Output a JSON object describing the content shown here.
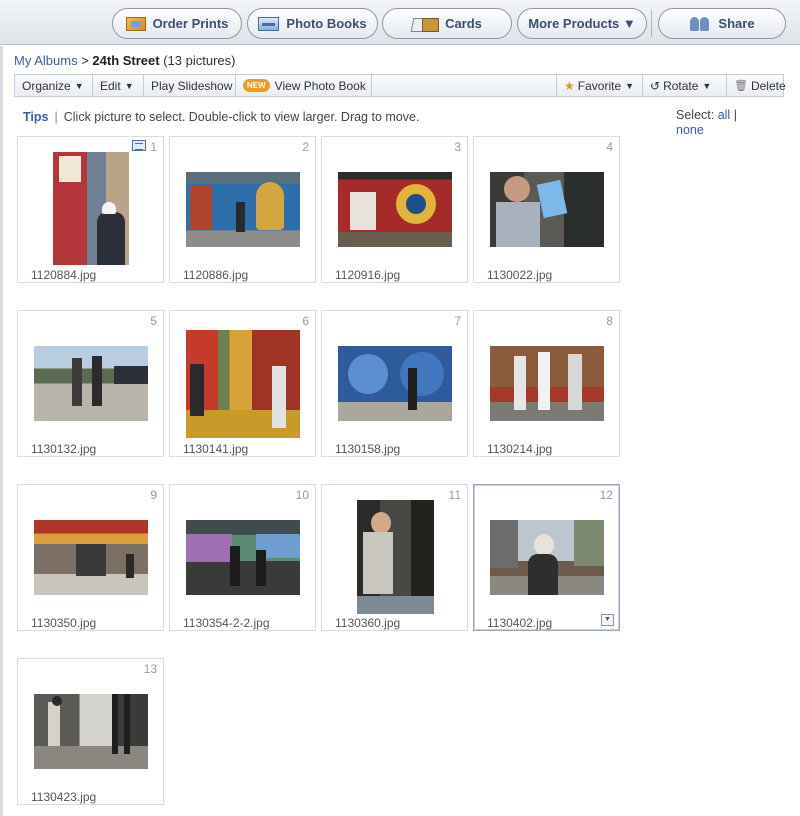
{
  "topbar": {
    "buttons": [
      {
        "label": "Order Prints",
        "icon": "prints-icon"
      },
      {
        "label": "Photo Books",
        "icon": "photo-book-icon"
      },
      {
        "label": "Cards",
        "icon": "cards-icon"
      },
      {
        "label": "More Products ▼",
        "icon": ""
      },
      {
        "label": "Share",
        "icon": "share-icon"
      }
    ]
  },
  "breadcrumb": {
    "root": "My Albums",
    "separator": " > ",
    "album": "24th Street",
    "count": " (13 pictures)"
  },
  "toolbar": {
    "organize": "Organize",
    "edit": "Edit",
    "slideshow": "Play Slideshow",
    "new_badge": "NEW",
    "photo_book": "View Photo Book",
    "favorite": "Favorite",
    "rotate": "Rotate",
    "delete": "Delete"
  },
  "tips": {
    "label": "Tips",
    "text": "Click picture to select. Double-click to view larger. Drag to move."
  },
  "select": {
    "label": "Select:",
    "all": "all",
    "none": "none"
  },
  "photos": [
    {
      "num": "1",
      "name": "1120884.jpg"
    },
    {
      "num": "2",
      "name": "1120886.jpg"
    },
    {
      "num": "3",
      "name": "1120916.jpg"
    },
    {
      "num": "4",
      "name": "1130022.jpg"
    },
    {
      "num": "5",
      "name": "1130132.jpg"
    },
    {
      "num": "6",
      "name": "1130141.jpg"
    },
    {
      "num": "7",
      "name": "1130158.jpg"
    },
    {
      "num": "8",
      "name": "1130214.jpg"
    },
    {
      "num": "9",
      "name": "1130350.jpg"
    },
    {
      "num": "10",
      "name": "1130354-2-2.jpg"
    },
    {
      "num": "11",
      "name": "1130360.jpg"
    },
    {
      "num": "12",
      "name": "1130402.jpg"
    },
    {
      "num": "13",
      "name": "1130423.jpg"
    }
  ],
  "colors": {
    "link": "#3a5ea8",
    "button_text": "#3c4f72",
    "new_badge": "#f39a1d"
  }
}
